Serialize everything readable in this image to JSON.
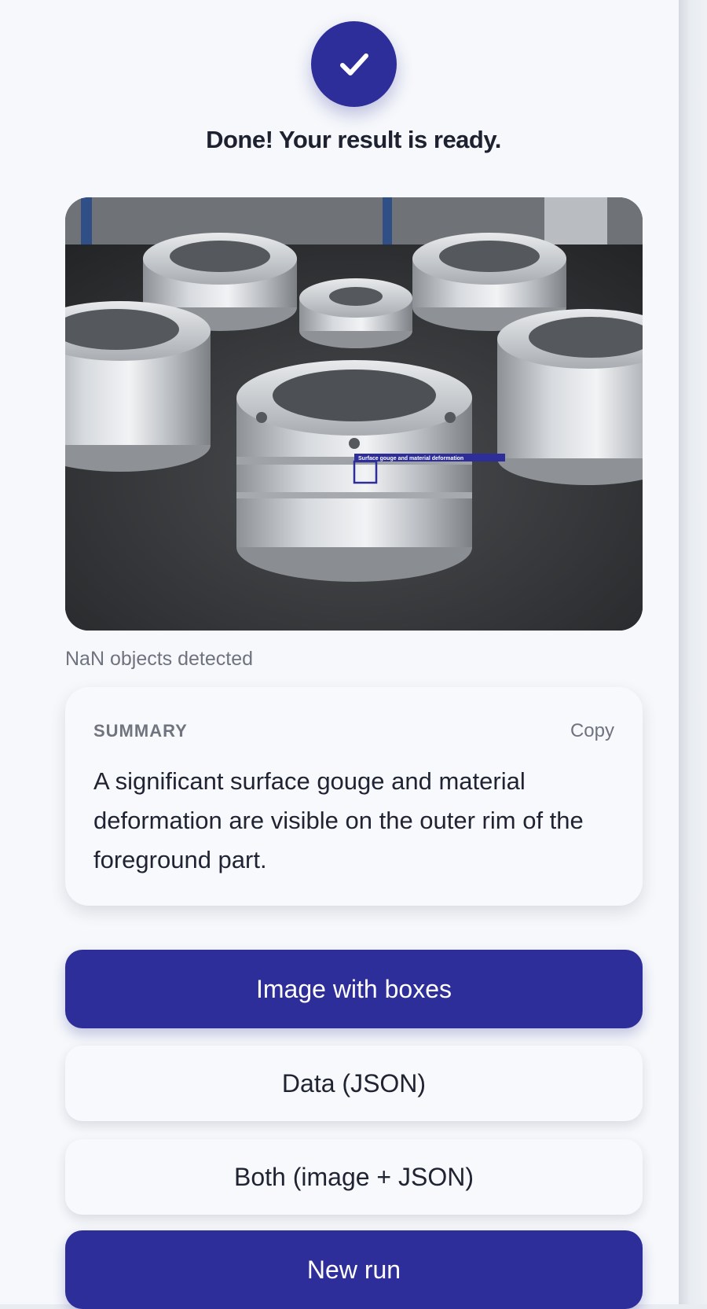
{
  "status": {
    "icon": "check-icon",
    "title": "Done! Your result is ready."
  },
  "result": {
    "detection_label": "Surface gouge and material deformation",
    "objects_detected": "NaN objects detected"
  },
  "summary": {
    "heading": "SUMMARY",
    "copy_label": "Copy",
    "text": "A significant surface gouge and material deformation are visible on the outer rim of the foreground part."
  },
  "actions": {
    "image_with_boxes": "Image with boxes",
    "data_json": "Data (JSON)",
    "both": "Both (image + JSON)",
    "new_run": "New run"
  },
  "colors": {
    "accent": "#2e2e9b",
    "background": "#f6f8fb",
    "text": "#1f2332"
  }
}
